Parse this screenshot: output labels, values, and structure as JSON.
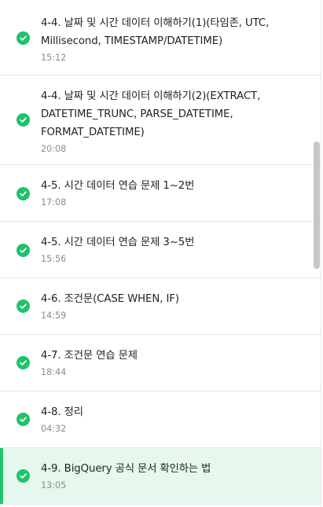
{
  "lectures": [
    {
      "title": "4-4. 날짜 및 시간 데이터 이해하기(1)(타임존, UTC, Millisecond, TIMESTAMP/DATETIME)",
      "duration": "15:12",
      "completed": true
    },
    {
      "title": "4-4. 날짜 및 시간 데이터 이해하기(2)(EXTRACT, DATETIME_TRUNC, PARSE_DATETIME, FORMAT_DATETIME)",
      "duration": "20:08",
      "completed": true
    },
    {
      "title": "4-5. 시간 데이터 연습 문제 1~2번",
      "duration": "17:08",
      "completed": true
    },
    {
      "title": "4-5. 시간 데이터 연습 문제 3~5번",
      "duration": "15:56",
      "completed": true
    },
    {
      "title": "4-6. 조건문(CASE WHEN, IF)",
      "duration": "14:59",
      "completed": true
    },
    {
      "title": "4-7. 조건문 연습 문제",
      "duration": "18:44",
      "completed": true
    },
    {
      "title": "4-8. 정리",
      "duration": "04:32",
      "completed": true
    },
    {
      "title": "4-9. BigQuery 공식 문서 확인하는 법",
      "duration": "13:05",
      "completed": true,
      "active": true
    }
  ],
  "colors": {
    "check": "#1fc26a",
    "active_background": "#e6f7ee",
    "active_bar": "#25c26e",
    "title_text": "#222222",
    "duration_text": "#8c8c8c"
  },
  "icons": {
    "completed": "check-circle-icon"
  }
}
